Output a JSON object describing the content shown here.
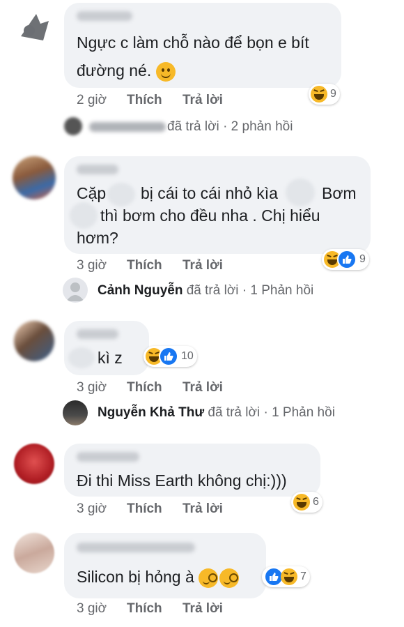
{
  "comments": [
    {
      "text_lines": [
        "Ngực c làm chỗ nào để bọn e bít",
        "đường né."
      ],
      "time": "2 giờ",
      "like_label": "Thích",
      "reply_label": "Trả lời",
      "reaction_count": "9",
      "reply_summary": {
        "replier": "",
        "action": "đã trả lời",
        "separator": "·",
        "count": "2 phản hồi"
      }
    },
    {
      "text_lines": [
        "Cặp",
        "bị cái to cái nhỏ kìa",
        "Bơm",
        "thì bơm cho đều nha . Chị hiểu",
        "hơm?"
      ],
      "time": "3 giờ",
      "like_label": "Thích",
      "reply_label": "Trả lời",
      "reaction_count": "9",
      "reply_summary": {
        "replier": "Cảnh Nguyễn",
        "action": "đã trả lời",
        "separator": "·",
        "count": "1 Phản hồi"
      }
    },
    {
      "text_lines": [
        "kì z"
      ],
      "time": "3 giờ",
      "like_label": "Thích",
      "reply_label": "Trả lời",
      "reaction_count": "10",
      "reply_summary": {
        "replier": "Nguyễn Khả Thư",
        "action": "đã trả lời",
        "separator": "·",
        "count": "1 Phản hồi"
      }
    },
    {
      "text_lines": [
        "Đi thi Miss Earth không chị:)))"
      ],
      "time": "3 giờ",
      "like_label": "Thích",
      "reply_label": "Trả lời",
      "reaction_count": "6"
    },
    {
      "text_lines": [
        "Silicon bị hỏng à"
      ],
      "time": "3 giờ",
      "like_label": "Thích",
      "reply_label": "Trả lời",
      "reaction_count": "7"
    }
  ],
  "icons": {
    "haha": "haha-reaction-icon",
    "like": "like-reaction-icon",
    "smile": "slightly-smiling-face-emoji",
    "monocle": "face-with-monocle-emoji"
  },
  "colors": {
    "bubble": "#f0f2f5",
    "meta": "#65676b",
    "like_blue": "#1877f2",
    "haha_yellow": "#f7b928"
  }
}
